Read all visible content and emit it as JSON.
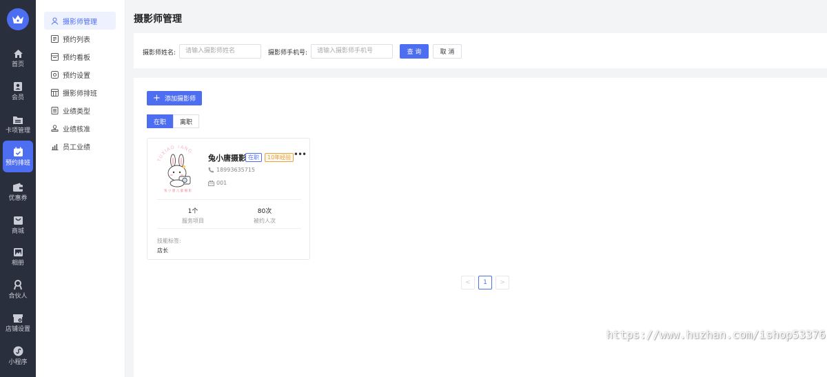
{
  "rail": {
    "items": [
      {
        "label": "首页",
        "icon": "home-icon"
      },
      {
        "label": "会员",
        "icon": "member-icon"
      },
      {
        "label": "卡项管理",
        "icon": "folder-icon"
      },
      {
        "label": "预约排班",
        "icon": "calendar-icon"
      },
      {
        "label": "优惠券",
        "icon": "wallet-icon"
      },
      {
        "label": "商城",
        "icon": "shop-icon"
      },
      {
        "label": "相册",
        "icon": "album-icon"
      },
      {
        "label": "合伙人",
        "icon": "partner-icon"
      },
      {
        "label": "店铺设置",
        "icon": "store-settings-icon"
      },
      {
        "label": "小程序",
        "icon": "miniapp-icon"
      }
    ],
    "active_index": 3
  },
  "submenu": {
    "items": [
      {
        "label": "摄影师管理"
      },
      {
        "label": "预约列表"
      },
      {
        "label": "预约看板"
      },
      {
        "label": "预约设置"
      },
      {
        "label": "摄影师排班"
      },
      {
        "label": "业绩类型"
      },
      {
        "label": "业绩核准"
      },
      {
        "label": "员工业绩"
      }
    ],
    "active_index": 0
  },
  "page": {
    "title": "摄影师管理"
  },
  "filter": {
    "name_label": "摄影师姓名:",
    "name_placeholder": "请输入摄影师姓名",
    "phone_label": "摄影师手机号:",
    "phone_placeholder": "请输入摄影师手机号",
    "query_label": "查 询",
    "cancel_label": "取 消"
  },
  "actions": {
    "add_label": "添加摄影师"
  },
  "tabs": [
    {
      "label": "在职",
      "active": true
    },
    {
      "label": "离职",
      "active": false
    }
  ],
  "photographers": [
    {
      "name": "兔小唐摄影",
      "status": "在职",
      "experience": "10年经验",
      "phone": "18993635715",
      "code": "001",
      "service_count": "1个",
      "service_label": "服务项目",
      "booked_count": "80次",
      "booked_label": "被约人次",
      "skill_label": "技能标签:",
      "skill_value": "店长",
      "avatar_text_top": "TUXIAO TANG",
      "avatar_text_bottom": "兔 小 唐 儿 童 摄 影"
    }
  ],
  "pagination": {
    "current": "1",
    "prev": "<",
    "next": ">"
  },
  "watermark": "https://www.huzhan.com/ishop53376",
  "colors": {
    "primary": "#4e6ef2",
    "rail": "#2a2f3e",
    "warning": "#e6a23c"
  }
}
